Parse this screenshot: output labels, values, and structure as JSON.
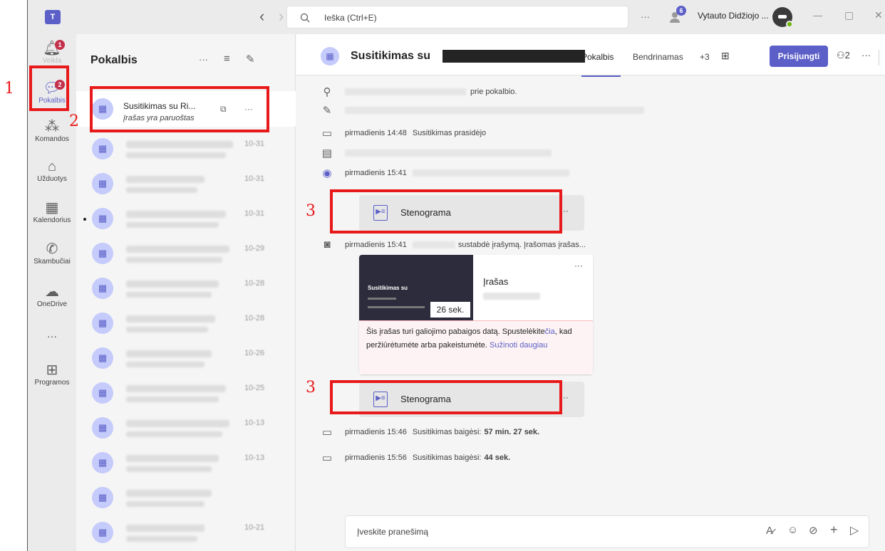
{
  "titlebar": {
    "search_placeholder": "Ieška (Ctrl+E)",
    "more": "···",
    "notif_count": "6",
    "org": "Vytauto Didžiojo ...",
    "minimize": "—",
    "maximize": "▢",
    "close": "✕",
    "back": "‹",
    "forward": "›"
  },
  "rail": {
    "items": [
      {
        "label": "Veikla",
        "icon": "bell-icon",
        "badge": "1"
      },
      {
        "label": "Pokalbis",
        "icon": "chat-icon",
        "badge": "2"
      },
      {
        "label": "Komandos",
        "icon": "teams-icon"
      },
      {
        "label": "Užduotys",
        "icon": "tasks-icon"
      },
      {
        "label": "Kalendorius",
        "icon": "calendar-icon"
      },
      {
        "label": "Skambučiai",
        "icon": "phone-icon"
      },
      {
        "label": "OneDrive",
        "icon": "cloud-icon"
      },
      {
        "label": "···",
        "icon": "more-icon"
      },
      {
        "label": "Programos",
        "icon": "apps-icon"
      }
    ]
  },
  "chatlist": {
    "title": "Pokalbis",
    "selected": {
      "title": "Susitikimas su Ri...",
      "subtitle": "Įrašas yra paruoštas",
      "more": "···"
    },
    "items": [
      {
        "time": "10-31"
      },
      {
        "time": "10-31"
      },
      {
        "time": "10-31"
      },
      {
        "time": "10-29"
      },
      {
        "time": "10-28"
      },
      {
        "time": "10-28"
      },
      {
        "time": "10-26"
      },
      {
        "time": "10-25"
      },
      {
        "time": "10-13"
      },
      {
        "time": "10-13"
      },
      {
        "time": ""
      },
      {
        "time": "10-21"
      }
    ]
  },
  "header": {
    "title": "Susitikimas su",
    "tab_chat": "Pokalbis",
    "tab_shared": "Bendrinamas",
    "tab_more": "+3",
    "join": "Prisijungti",
    "participants": "2",
    "more": "···"
  },
  "events": {
    "e1": "prie pokalbio.",
    "e2_time": "pirmadienis 14:48",
    "e2_text": "Susitikimas prasidėjo",
    "e3_time": "pirmadienis 15:41",
    "e4_time": "pirmadienis 15:41",
    "e4_text": "sustabdė įrašymą. Įrašomas įrašas...",
    "end1_time": "pirmadienis 15:46",
    "end1_text": "Susitikimas baigėsi:",
    "end1_dur": "57 min. 27 sek.",
    "end2_time": "pirmadienis 15:56",
    "end2_text": "Susitikimas baigėsi:",
    "end2_dur": "44 sek."
  },
  "steno": {
    "label": "Stenograma",
    "more": "···"
  },
  "recording": {
    "title": "Įrašas",
    "thumb_title": "Susitikimas su",
    "duration": "26 sek.",
    "more": "···",
    "notice_1": "Šis įrašas turi galiojimo pabaigos datą. Spustelėkite",
    "notice_link1": "čia",
    "notice_2": ", kad peržiūrėtumėte arba pakeistumėte.",
    "notice_link2": "Sužinoti daugiau"
  },
  "compose": {
    "placeholder": "Įveskite pranešimą"
  },
  "annotations": {
    "n1": "1",
    "n2": "2",
    "n3a": "3",
    "n3b": "3"
  },
  "colors": {
    "accent": "#5b5fc7",
    "annotation": "#e8191a",
    "badge": "#c4314b",
    "notice_bg": "#fdf3f4"
  }
}
